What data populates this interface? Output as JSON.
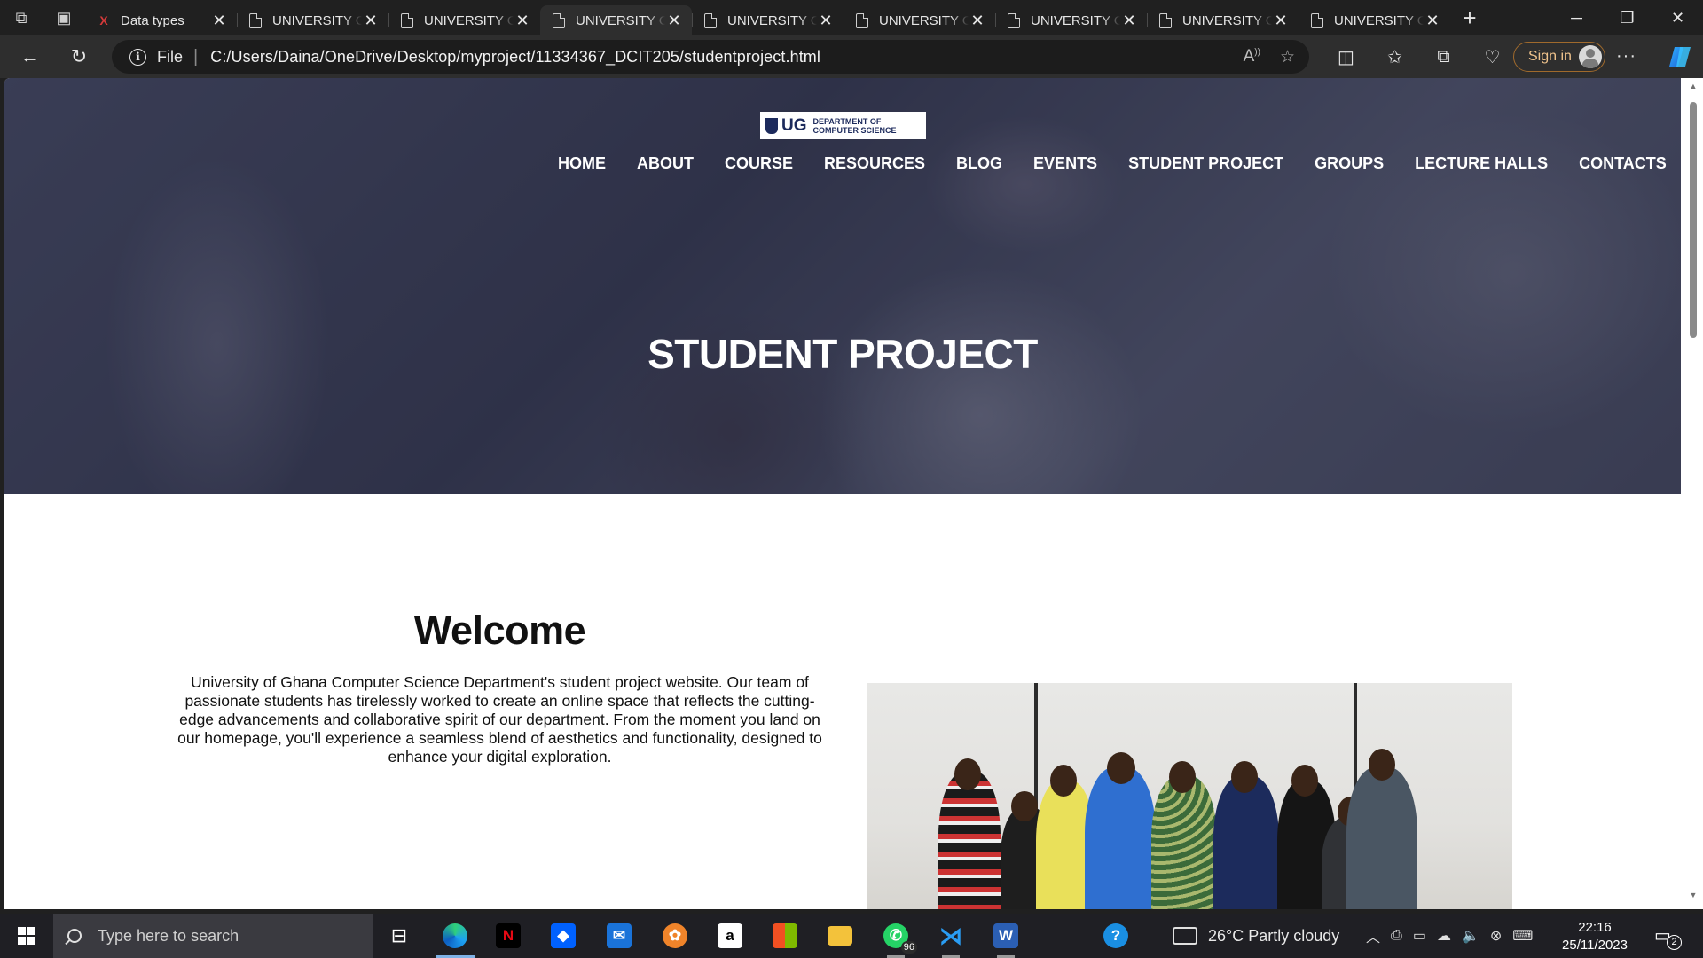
{
  "browser": {
    "tabs": [
      {
        "title": "Data types",
        "active": false
      },
      {
        "title": "UNIVERSITY OF GHANA",
        "active": false
      },
      {
        "title": "UNIVERSITY OF GHANA",
        "active": false
      },
      {
        "title": "UNIVERSITY OF GHANA",
        "active": true
      },
      {
        "title": "UNIVERSITY OF GHANA",
        "active": false
      },
      {
        "title": "UNIVERSITY OF GHANA",
        "active": false
      },
      {
        "title": "UNIVERSITY OF GHANA",
        "active": false
      },
      {
        "title": "UNIVERSITY OF GHANA",
        "active": false
      },
      {
        "title": "UNIVERSITY OF GHANA",
        "active": false
      }
    ],
    "address": {
      "scheme_label": "File",
      "url": "C:/Users/Daina/OneDrive/Desktop/myproject/11334367_DCIT205/studentproject.html"
    },
    "sign_in_label": "Sign in"
  },
  "page": {
    "logo": {
      "ug": "UG",
      "line1": "DEPARTMENT OF",
      "line2": "COMPUTER SCIENCE"
    },
    "nav": [
      "HOME",
      "ABOUT",
      "COURSE",
      "RESOURCES",
      "BLOG",
      "EVENTS",
      "STUDENT PROJECT",
      "GROUPS",
      "LECTURE HALLS",
      "CONTACTS"
    ],
    "hero_title": "STUDENT PROJECT",
    "welcome": {
      "title": "Welcome",
      "text": "University of Ghana Computer Science Department's student project website. Our team of passionate students has tirelessly worked to create an online space that reflects the cutting-edge advancements and collaborative spirit of our department. From the moment you land on our homepage, you'll experience a seamless blend of aesthetics and functionality, designed to enhance your digital exploration."
    }
  },
  "taskbar": {
    "search_placeholder": "Type here to search",
    "whatsapp_badge": "96",
    "weather": "26°C  Partly cloudy",
    "time": "22:16",
    "date": "25/11/2023",
    "notification_count": "2"
  },
  "colors": {
    "chrome_dark": "#202020",
    "toolbar": "#2e2e2e",
    "signin_accent": "#f0c38c",
    "taskbar": "#1f1f24"
  }
}
